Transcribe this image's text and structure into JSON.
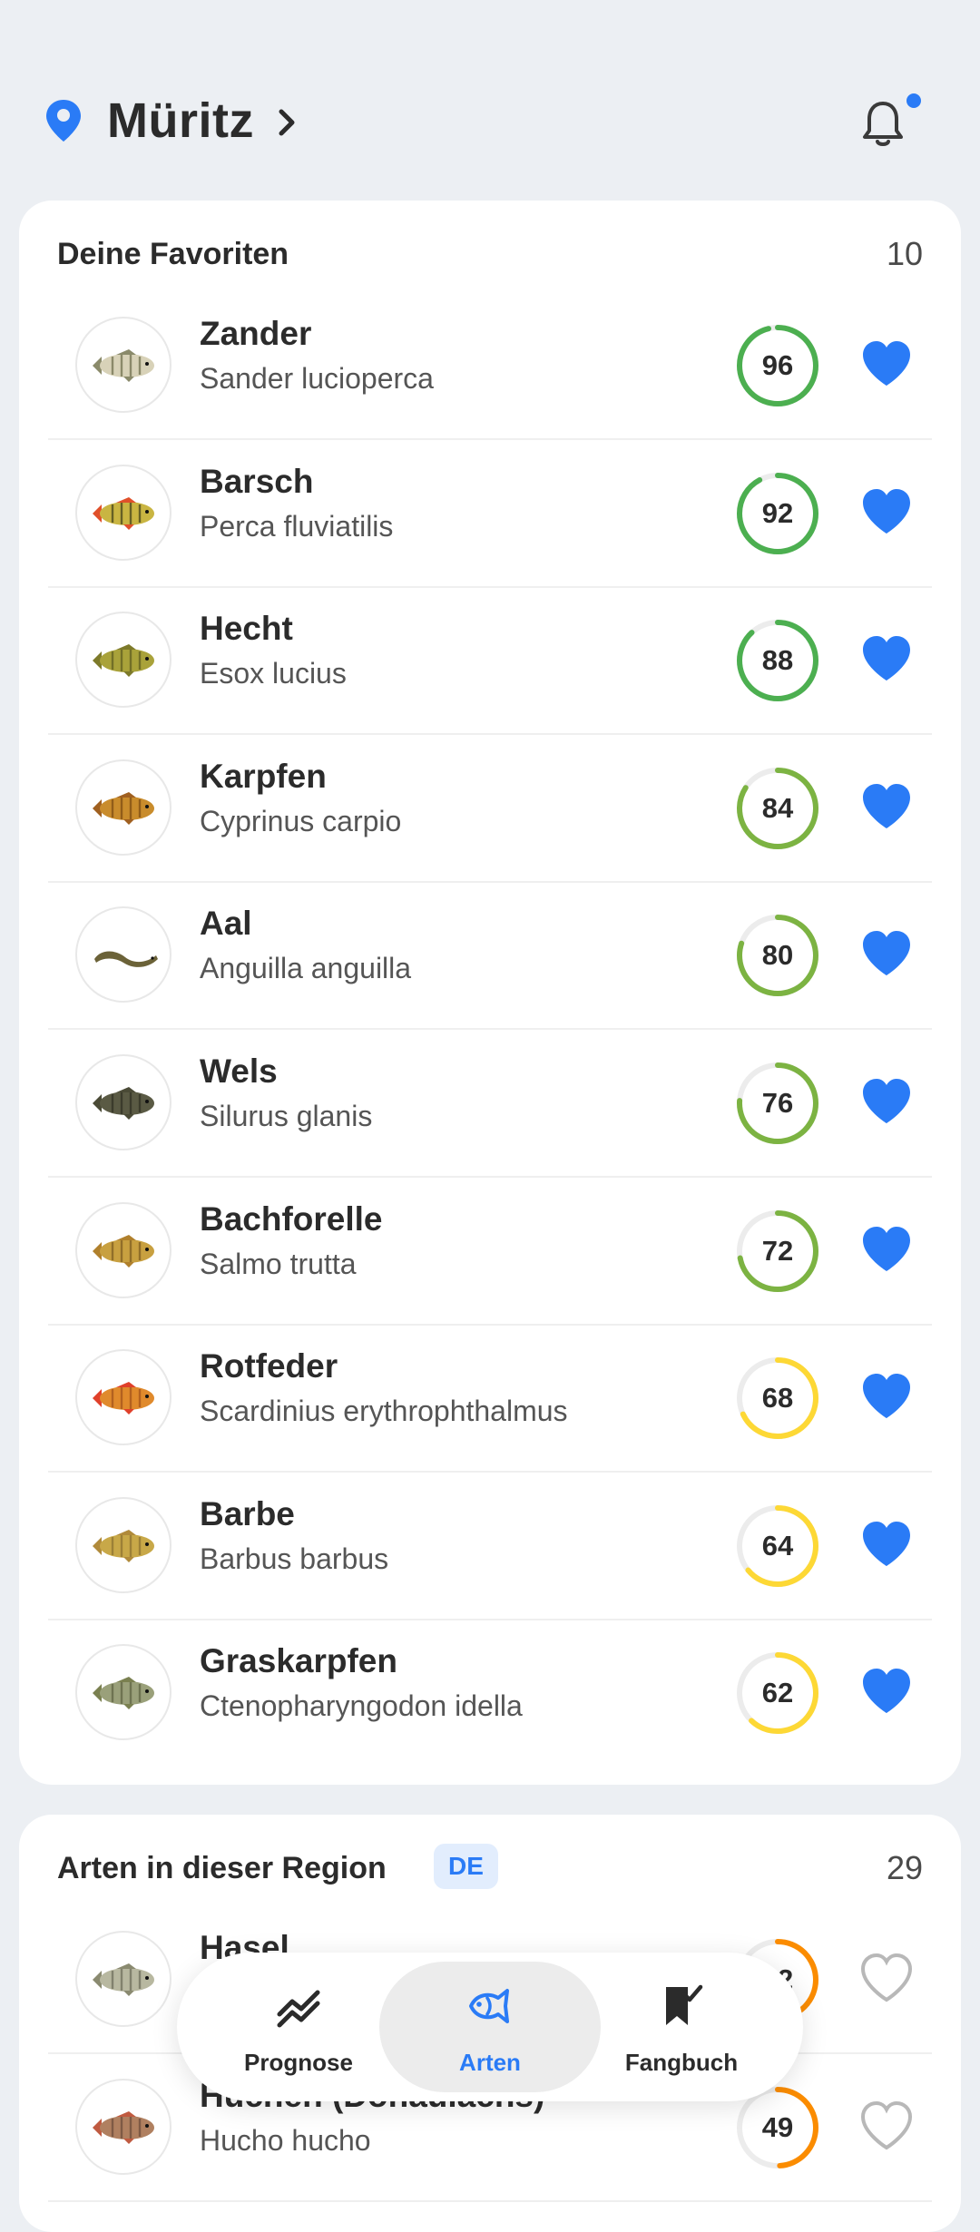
{
  "header": {
    "location": "Müritz"
  },
  "favorites": {
    "title": "Deine Favoriten",
    "count": "10",
    "items": [
      {
        "name": "Zander",
        "scientific": "Sander lucioperca",
        "score": 96,
        "favorite": true,
        "ring_color": "#4caf50"
      },
      {
        "name": "Barsch",
        "scientific": "Perca fluviatilis",
        "score": 92,
        "favorite": true,
        "ring_color": "#4caf50"
      },
      {
        "name": "Hecht",
        "scientific": "Esox lucius",
        "score": 88,
        "favorite": true,
        "ring_color": "#4caf50"
      },
      {
        "name": "Karpfen",
        "scientific": "Cyprinus carpio",
        "score": 84,
        "favorite": true,
        "ring_color": "#7cb342"
      },
      {
        "name": "Aal",
        "scientific": "Anguilla anguilla",
        "score": 80,
        "favorite": true,
        "ring_color": "#7cb342"
      },
      {
        "name": "Wels",
        "scientific": "Silurus glanis",
        "score": 76,
        "favorite": true,
        "ring_color": "#7cb342"
      },
      {
        "name": "Bachforelle",
        "scientific": "Salmo trutta",
        "score": 72,
        "favorite": true,
        "ring_color": "#7cb342"
      },
      {
        "name": "Rotfeder",
        "scientific": "Scardinius erythrophthalmus",
        "score": 68,
        "favorite": true,
        "ring_color": "#fdd835"
      },
      {
        "name": "Barbe",
        "scientific": "Barbus barbus",
        "score": 64,
        "favorite": true,
        "ring_color": "#fdd835"
      },
      {
        "name": "Graskarpfen",
        "scientific": "Ctenopharyngodon idella",
        "score": 62,
        "favorite": true,
        "ring_color": "#fdd835"
      }
    ]
  },
  "region": {
    "title": "Arten in dieser Region",
    "badge": "DE",
    "count": "29",
    "items": [
      {
        "name": "Hasel",
        "scientific": "",
        "score": 52,
        "favorite": false,
        "ring_color": "#fb8c00"
      },
      {
        "name": "Huchen (Donaulachs)",
        "scientific": "Hucho hucho",
        "score": 49,
        "favorite": false,
        "ring_color": "#fb8c00"
      }
    ]
  },
  "nav": {
    "items": [
      {
        "label": "Prognose",
        "icon": "trend-chart-icon",
        "active": false
      },
      {
        "label": "Arten",
        "icon": "fish-icon",
        "active": true
      },
      {
        "label": "Fangbuch",
        "icon": "logbook-flag-icon",
        "active": false
      }
    ]
  },
  "colors": {
    "accent": "#2a7bf6",
    "background": "#eceff3"
  }
}
